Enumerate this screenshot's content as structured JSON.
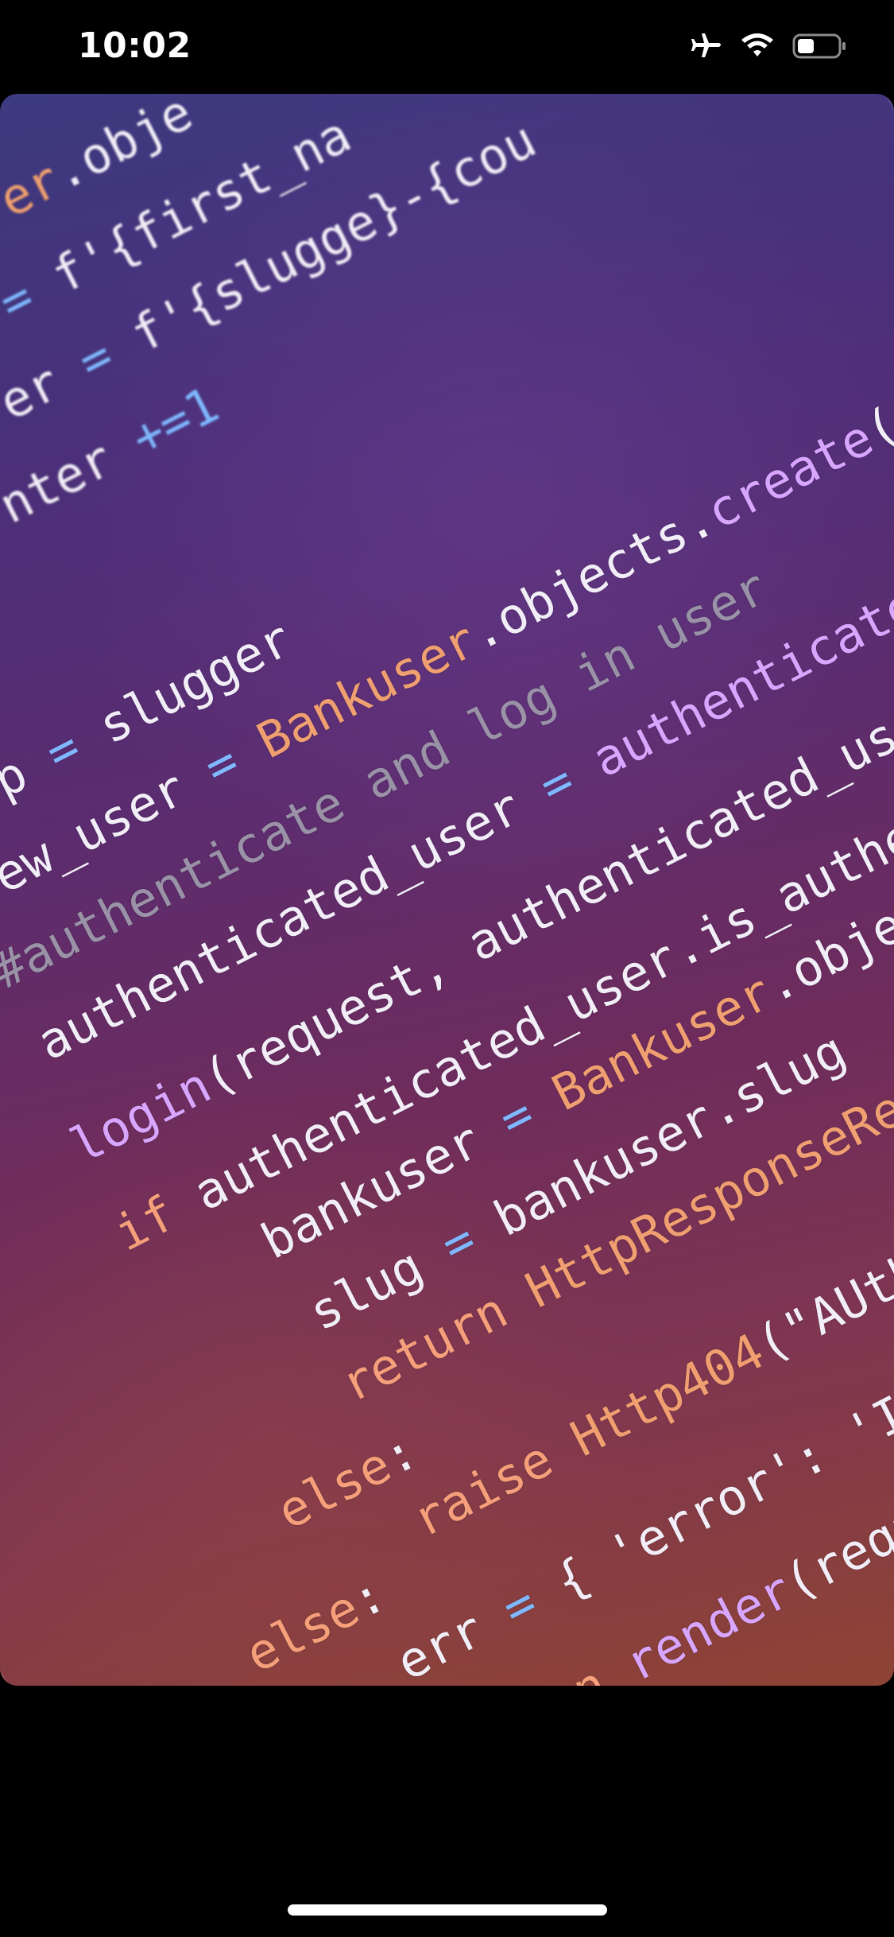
{
  "status_bar": {
    "time": "10:02",
    "icons": [
      "airplane-icon",
      "wifi-icon",
      "battery-icon"
    ]
  },
  "photo": {
    "lines": [
      {
        "indent": 0,
        "blur": true,
        "tokens": [
          {
            "t": "er",
            "c": "t-class"
          },
          {
            "t": ".obje",
            "c": "t-white"
          }
        ]
      },
      {
        "indent": 0,
        "blur": true,
        "tokens": [
          {
            "t": "= ",
            "c": "t-op"
          },
          {
            "t": "f'{first_na",
            "c": "t-white"
          }
        ]
      },
      {
        "indent": 0,
        "blur": true,
        "tokens": [
          {
            "t": "er ",
            "c": "t-white"
          },
          {
            "t": "= ",
            "c": "t-op"
          },
          {
            "t": "f'{slugge}-{cou",
            "c": "t-white"
          }
        ]
      },
      {
        "indent": 0,
        "blur": true,
        "tokens": [
          {
            "t": "nter ",
            "c": "t-white"
          },
          {
            "t": "+=1",
            "c": "t-op"
          }
        ]
      },
      {
        "indent": 0,
        "blur": false,
        "tokens": [
          {
            "t": "p ",
            "c": "t-white"
          },
          {
            "t": "= ",
            "c": "t-op"
          },
          {
            "t": "slugger",
            "c": "t-white"
          }
        ]
      },
      {
        "indent": 0,
        "blur": false,
        "tokens": [
          {
            "t": "ew_user ",
            "c": "t-white"
          },
          {
            "t": "= ",
            "c": "t-op"
          },
          {
            "t": "Bankuser",
            "c": "t-class"
          },
          {
            "t": ".objects.",
            "c": "t-white"
          },
          {
            "t": "create",
            "c": "t-fn"
          },
          {
            "t": "(f",
            "c": "t-white"
          }
        ]
      },
      {
        "indent": 0,
        "blur": false,
        "tokens": [
          {
            "t": "#authenticate and log in user",
            "c": "t-cmt"
          }
        ]
      },
      {
        "indent": 0,
        "blur": false,
        "tokens": [
          {
            "t": "authenticated_user ",
            "c": "t-white"
          },
          {
            "t": "= ",
            "c": "t-op"
          },
          {
            "t": "authenticate",
            "c": "t-fn"
          }
        ]
      },
      {
        "indent": 0,
        "blur": false,
        "tokens": [
          {
            "t": "login",
            "c": "t-fn"
          },
          {
            "t": "(request, authenticated_us",
            "c": "t-white"
          }
        ]
      },
      {
        "indent": 1,
        "blur": false,
        "tokens": [
          {
            "t": "if ",
            "c": "t-kw"
          },
          {
            "t": "authenticated_user.is_authe",
            "c": "t-white"
          }
        ]
      },
      {
        "indent": 2,
        "blur": false,
        "tokens": [
          {
            "t": "bankuser ",
            "c": "t-white"
          },
          {
            "t": "= ",
            "c": "t-op"
          },
          {
            "t": "Bankuser",
            "c": "t-class"
          },
          {
            "t": ".obje",
            "c": "t-white"
          }
        ]
      },
      {
        "indent": 2,
        "blur": false,
        "tokens": [
          {
            "t": "slug ",
            "c": "t-white"
          },
          {
            "t": "= ",
            "c": "t-op"
          },
          {
            "t": "bankuser.slug",
            "c": "t-white"
          }
        ]
      },
      {
        "indent": 2,
        "blur": false,
        "tokens": [
          {
            "t": "return ",
            "c": "t-kw"
          },
          {
            "t": "HttpResponseRe",
            "c": "t-class"
          }
        ]
      },
      {
        "indent": 1,
        "blur": false,
        "tokens": [
          {
            "t": "else",
            "c": "t-kw"
          },
          {
            "t": ":",
            "c": "t-white"
          }
        ]
      },
      {
        "indent": 2,
        "blur": false,
        "tokens": [
          {
            "t": "raise ",
            "c": "t-kw"
          },
          {
            "t": "Http404",
            "c": "t-class"
          },
          {
            "t": "(\"AUth",
            "c": "t-white"
          }
        ]
      },
      {
        "indent": 0,
        "blur": false,
        "tokens": [
          {
            "t": "else",
            "c": "t-kw"
          },
          {
            "t": ":",
            "c": "t-white"
          }
        ]
      },
      {
        "indent": 1,
        "blur": false,
        "tokens": [
          {
            "t": "err ",
            "c": "t-white"
          },
          {
            "t": "= ",
            "c": "t-op"
          },
          {
            "t": "{ 'error': 'I",
            "c": "t-white"
          }
        ]
      },
      {
        "indent": 1,
        "blur": false,
        "tokens": [
          {
            "t": "return ",
            "c": "t-kw"
          },
          {
            "t": "render",
            "c": "t-fn"
          },
          {
            "t": "(requ",
            "c": "t-white"
          }
        ]
      }
    ]
  }
}
